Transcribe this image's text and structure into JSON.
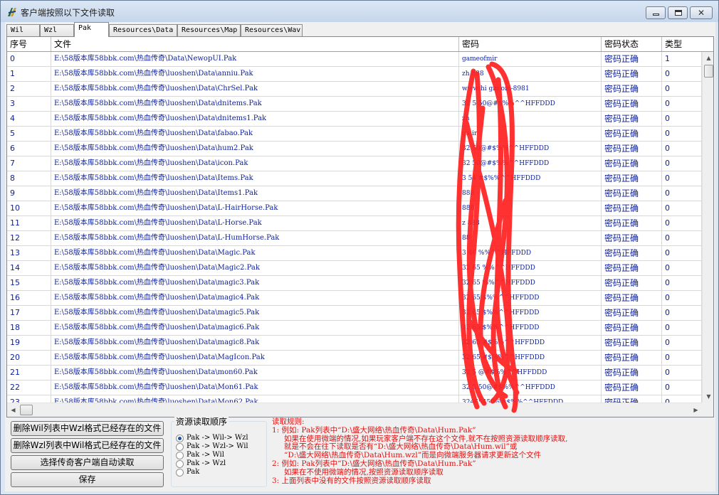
{
  "window": {
    "title": "客户端按照以下文件读取"
  },
  "tabs": [
    "Wil",
    "Wzl",
    "Pak",
    "Resources\\Data",
    "Resources\\Map",
    "Resources\\Wav"
  ],
  "active_tab": "Pak",
  "table": {
    "columns": [
      "序号",
      "文件",
      "密码",
      "密码状态",
      "类型"
    ],
    "rows": [
      {
        "idx": "0",
        "file": "E:\\58版本库58bbk.com\\热血传奇\\Data\\NewopUI.Pak",
        "pwd": "gameofmir",
        "state": "密码正确",
        "type": "1"
      },
      {
        "idx": "1",
        "file": "E:\\58版本库58bbk.com\\热血传奇\\luoshen\\Data\\anniu.Pak",
        "pwd": "zh  888",
        "state": "密码正确",
        "type": "0"
      },
      {
        "idx": "2",
        "file": "E:\\58版本库58bbk.com\\热血传奇\\luoshen\\Data\\ChrSel.Pak",
        "pwd": "www  hi  gm   om-8981",
        "state": "密码正确",
        "type": "0"
      },
      {
        "idx": "3",
        "file": "E:\\58版本库58bbk.com\\热血传奇\\luoshen\\Data\\dnitems.Pak",
        "pwd": "32   5  50@#$%%^^HFFDDD",
        "state": "密码正确",
        "type": "0"
      },
      {
        "idx": "4",
        "file": "E:\\58版本库58bbk.com\\热血传奇\\luoshen\\Data\\dnitems1.Pak",
        "pwd": "zh",
        "state": "密码正确",
        "type": "0"
      },
      {
        "idx": "5",
        "file": "E:\\58版本库58bbk.com\\热血传奇\\luoshen\\Data\\fabao.Pak",
        "pwd": "ga     ir",
        "state": "密码正确",
        "type": "0"
      },
      {
        "idx": "6",
        "file": "E:\\58版本库58bbk.com\\热血传奇\\luoshen\\Data\\hum2.Pak",
        "pwd": "32    50@#$%%^^HFFDDD",
        "state": "密码正确",
        "type": "0"
      },
      {
        "idx": "7",
        "file": "E:\\58版本库58bbk.com\\热血传奇\\luoshen\\Data\\icon.Pak",
        "pwd": "32    50@#$%%^^HFFDDD",
        "state": "密码正确",
        "type": "0"
      },
      {
        "idx": "8",
        "file": "E:\\58版本库58bbk.com\\热血传奇\\luoshen\\Data\\Items.Pak",
        "pwd": "3    54  #$%%^^HFFDDD",
        "state": "密码正确",
        "type": "0"
      },
      {
        "idx": "9",
        "file": "E:\\58版本库58bbk.com\\热血传奇\\luoshen\\Data\\Items1.Pak",
        "pwd": "     888",
        "state": "密码正确",
        "type": "0"
      },
      {
        "idx": "10",
        "file": "E:\\58版本库58bbk.com\\热血传奇\\luoshen\\Data\\L-HairHorse.Pak",
        "pwd": "     888",
        "state": "密码正确",
        "type": "0"
      },
      {
        "idx": "11",
        "file": "E:\\58版本库58bbk.com\\热血传奇\\luoshen\\Data\\L-Horse.Pak",
        "pwd": "z    888",
        "state": "密码正确",
        "type": "0"
      },
      {
        "idx": "12",
        "file": "E:\\58版本库58bbk.com\\热血传奇\\luoshen\\Data\\L-HumHorse.Pak",
        "pwd": "     88",
        "state": "密码正确",
        "type": "0"
      },
      {
        "idx": "13",
        "file": "E:\\58版本库58bbk.com\\热血传奇\\luoshen\\Data\\Magic.Pak",
        "pwd": "3    46    %%^^HFFDDD",
        "state": "密码正确",
        "type": "0"
      },
      {
        "idx": "14",
        "file": "E:\\58版本库58bbk.com\\热血传奇\\luoshen\\Data\\Magic2.Pak",
        "pwd": "32   65    %%^^HFFDDD",
        "state": "密码正确",
        "type": "0"
      },
      {
        "idx": "15",
        "file": "E:\\58版本库58bbk.com\\热血传奇\\luoshen\\Data\\magic3.Pak",
        "pwd": "32   65    %%^^HFFDDD",
        "state": "密码正确",
        "type": "0"
      },
      {
        "idx": "16",
        "file": "E:\\58版本库58bbk.com\\热血传奇\\luoshen\\Data\\magic4.Pak",
        "pwd": "32   65   $%%^^HFFDDD",
        "state": "密码正确",
        "type": "0"
      },
      {
        "idx": "17",
        "file": "E:\\58版本库58bbk.com\\热血传奇\\luoshen\\Data\\magic5.Pak",
        "pwd": "32   65   $%%^^HFFDDD",
        "state": "密码正确",
        "type": "0"
      },
      {
        "idx": "18",
        "file": "E:\\58版本库58bbk.com\\热血传奇\\luoshen\\Data\\magic6.Pak",
        "pwd": "32   65   $%%^^HFFDDD",
        "state": "密码正确",
        "type": "0"
      },
      {
        "idx": "19",
        "file": "E:\\58版本库58bbk.com\\热血传奇\\luoshen\\Data\\magic8.Pak",
        "pwd": "32   65   #$%%^^HFFDDD",
        "state": "密码正确",
        "type": "0"
      },
      {
        "idx": "20",
        "file": "E:\\58版本库58bbk.com\\热血传奇\\luoshen\\Data\\MagIcon.Pak",
        "pwd": "32   65   #$%%^^HFFDDD",
        "state": "密码正确",
        "type": "0"
      },
      {
        "idx": "21",
        "file": "E:\\58版本库58bbk.com\\热血传奇\\luoshen\\Data\\mon60.Pak",
        "pwd": "32   5   @#$%%^^HFFDDD",
        "state": "密码正确",
        "type": "0"
      },
      {
        "idx": "22",
        "file": "E:\\58版本库58bbk.com\\热血传奇\\luoshen\\Data\\Mon61.Pak",
        "pwd": "32   5  50@#$%%^^HFFDDD",
        "state": "密码正确",
        "type": "0"
      },
      {
        "idx": "23",
        "file": "E:\\58版本库58bbk.com\\热血传奇\\luoshen\\Data\\Mon62.Pak",
        "pwd": "32465450@#$%%^^HFFDDD",
        "state": "密码正确",
        "type": "0"
      }
    ]
  },
  "buttons": {
    "delete_wzl": "删除Wil列表中Wzl格式已经存在的文件",
    "delete_wil": "删除Wzl列表中Wil格式已经存在的文件",
    "select_client": "选择传奇客户端自动读取",
    "save": "保存"
  },
  "read_order": {
    "title": "资源读取顺序",
    "options": [
      "Pak -> Wil-> Wzl",
      "Pak -> Wzl-> Wil",
      "Pak -> Wil",
      "Pak -> Wzl",
      "Pak"
    ],
    "selected_index": 0
  },
  "rules": [
    "读取规则:",
    "1: 例如: Pak列表中“D:\\盛大网络\\热血传奇\\Data\\Hum.Pak”",
    "如果在使用微端的情况,如果玩家客户端不存在这个文件,就不在按照资源读取顺序读取,",
    "就是不会在往下读取是否有“D:\\盛大网络\\热血传奇\\Data\\Hum.wil”或",
    "“D:\\盛大网络\\热血传奇\\Data\\Hum.wzl”而是向微端服务器请求更新这个文件",
    "2: 例如: Pak列表中“D:\\盛大网络\\热血传奇\\Data\\Hum.Pak”",
    "如果在不使用微端的情况,按照资源读取顺序读取",
    "3: 上面列表中没有的文件按照资源读取顺序读取"
  ],
  "colors": {
    "link_text": "#0a1e9c",
    "rules_text": "#e01010",
    "scribble": "#ff2020"
  },
  "icons": {
    "app": "app-logo-icon",
    "minimize": "minimize-icon",
    "maximize": "maximize-icon",
    "close": "close-icon",
    "scroll_up": "arrow-up-icon",
    "scroll_down": "arrow-down-icon",
    "scroll_left": "arrow-left-icon",
    "scroll_right": "arrow-right-icon"
  }
}
